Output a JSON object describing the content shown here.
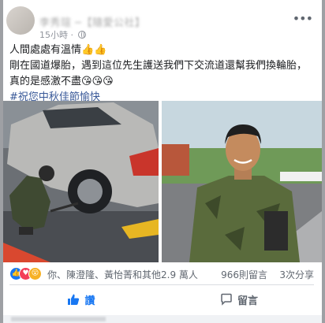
{
  "post": {
    "author_name": "李秀瑄 ─【隨愛公社】",
    "timestamp": "15小時",
    "more_label": "•••",
    "text_line1": "人間處處有溫情👍👍",
    "text_line2": "剛在國道爆胎，遇到這位先生護送我們下交流道還幫我們換輪胎，真的是感激不盡😘😘😘",
    "hashtag": "#祝您中秋佳節愉快"
  },
  "reactions": {
    "names": "你、陳澄隆、黃怡菁和其他2.9 萬人",
    "comments": "966則留言",
    "shares": "3次分享",
    "icons": [
      "like-icon",
      "love-icon",
      "wow-icon"
    ]
  },
  "actions": {
    "like_label": "讚",
    "comment_label": "留言"
  },
  "colors": {
    "like_blue": "#1877f2",
    "love_red": "#f33e58",
    "wow_yellow": "#f7b125",
    "hashtag_blue": "#385898"
  }
}
